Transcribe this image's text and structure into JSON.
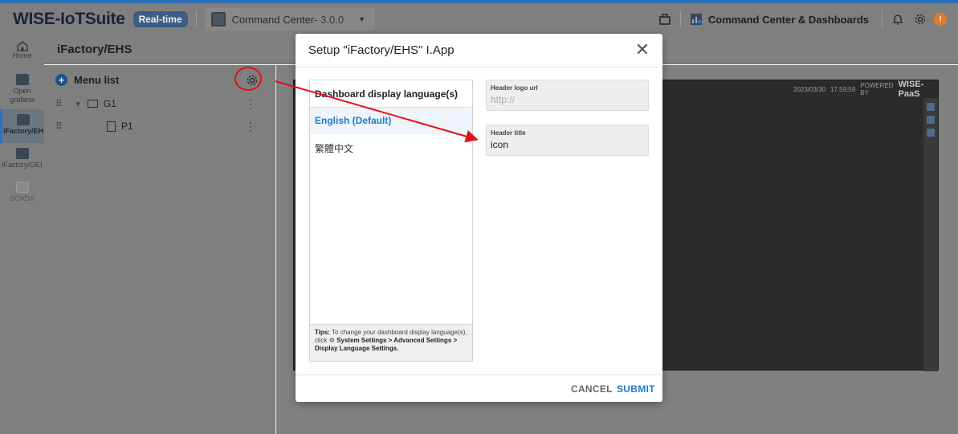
{
  "header": {
    "brand": "WISE-IoTSuite",
    "mode_badge": "Real-time",
    "app_name": "Command Center",
    "app_version": " - 3.0.0",
    "right_label": "Command Center & Dashboards",
    "alert_mark": "!",
    "icons": [
      "package-icon",
      "dashboard-icon",
      "bell-icon",
      "gear-icon"
    ]
  },
  "sidebar": {
    "items": [
      {
        "label": "Home",
        "icon": "home-icon"
      },
      {
        "label": "Open grafana",
        "icon": "grafana-icon"
      },
      {
        "label": "iFactory/EH",
        "icon": "app-icon",
        "active": true
      },
      {
        "label": "iFactory/OEI",
        "icon": "app-icon"
      },
      {
        "label": "SCADA",
        "icon": "scada-icon"
      }
    ]
  },
  "page": {
    "title": "iFactory/EHS"
  },
  "menu": {
    "title": "Menu list",
    "tree": [
      {
        "label": "G1",
        "type": "folder"
      },
      {
        "label": "P1",
        "type": "page"
      }
    ]
  },
  "preview": {
    "date": "2023/03/30",
    "time": "17:59:59",
    "powered_by": "POWERED BY",
    "brand": "WISE-PaaS"
  },
  "modal": {
    "title": "Setup \"iFactory/EHS\" I.App",
    "lang_header": "Dashboard display language(s)",
    "languages": [
      {
        "label": "English (Default)",
        "active": true
      },
      {
        "label": "繁體中文",
        "active": false
      }
    ],
    "tips_label": "Tips:",
    "tips_text": " To change your dashboard display language(s), click ",
    "tips_path": "System Settings > Advanced Settings > Display Language Settings.",
    "fields": {
      "logo_label": "Header logo url",
      "logo_placeholder": "http://",
      "title_label": "Header title",
      "title_value": "icon"
    },
    "cancel": "CANCEL",
    "submit": "SUBMIT"
  },
  "colors": {
    "accent": "#1f7ad0",
    "annotation": "#e0111b",
    "badge": "#3e5c86"
  }
}
